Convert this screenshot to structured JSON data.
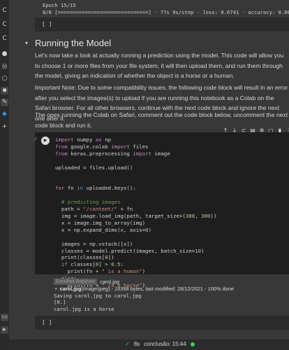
{
  "top_output": {
    "epoch_line": "Epoch 15/15",
    "progress_line": "8/8 [==============================] - 77s 9s/step - loss: 0.6741 - accuracy: 0.8889"
  },
  "empty_cell_prompt": "[ ]",
  "section": {
    "title": "Running the Model",
    "para1": "Let's now take a look at actually running a prediction using the model. This code will allow you to choose 1 or more files from your file system, it will then upload them, and run them through the model, giving an indication of whether the object is a horse or a human.",
    "para2": "Important Note: Due to some compatibility issues, the following code block will result in an error after you select the images(s) to upload if you are running this notebook as a Colab on the Safari browser. For all other browsers, continue with the next code block and ignore the next one after it.",
    "para3": "The ones running the Colab on Safari, comment out the code block below, uncomment the next code block and run it."
  },
  "toolbar_icons": [
    "arrow-up-icon",
    "arrow-down-icon",
    "link-icon",
    "comment-icon",
    "gear-icon",
    "mirror-icon",
    "delete-icon",
    "more-icon"
  ],
  "output": {
    "choose_files_label": "Escolher Arquivos",
    "chosen_file": "carol.jpg",
    "file_name": "carol.jpg",
    "file_meta": "(image/jpeg) - 16398 bytes, last modified: 28/12/2021 - 100% done",
    "saving": "Saving carol.jpg to carol.jpg",
    "array": "[0.]",
    "result": "carol.jpg is a horse"
  },
  "status": {
    "time": "8s",
    "done_label": "conclusão: 15:44"
  },
  "colors": {
    "background": "#383838",
    "code_bg": "#1e1e1e",
    "success": "#3ccf5b"
  }
}
